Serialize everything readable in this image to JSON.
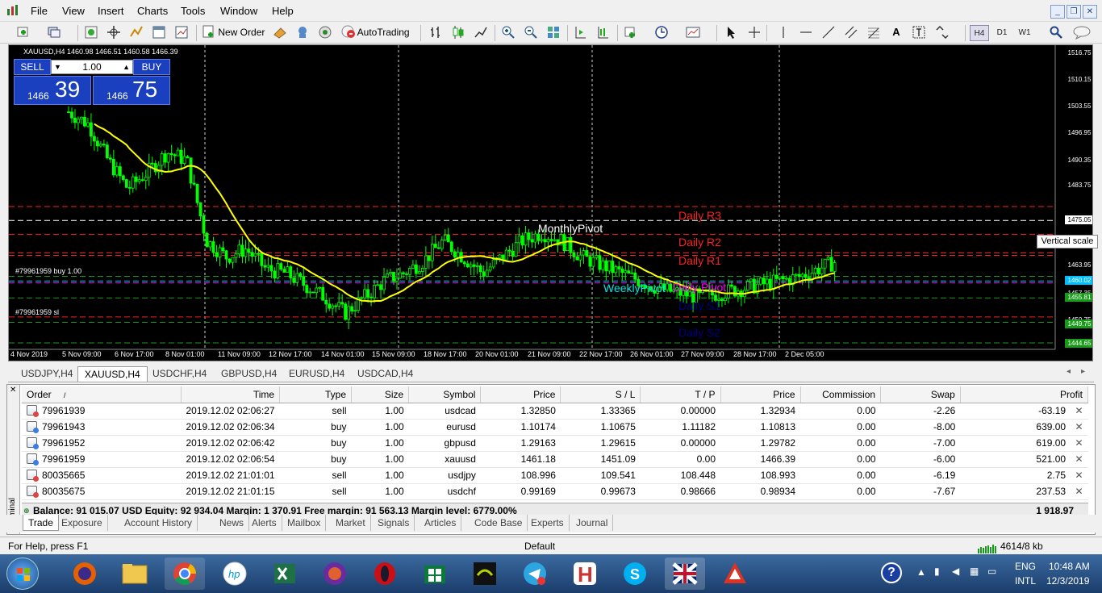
{
  "menu": [
    "File",
    "View",
    "Insert",
    "Charts",
    "Tools",
    "Window",
    "Help"
  ],
  "toolbar": {
    "new_order": "New Order",
    "auto_trading": "AutoTrading",
    "timeframes": [
      "H4",
      "D1",
      "W1"
    ]
  },
  "chart": {
    "header": "XAUUSD,H4  1460.98 1466.51 1460.58 1466.39",
    "lot": "1.00",
    "sell_label": "SELL",
    "buy_label": "BUY",
    "sell_big": "1466",
    "sell_small": "39",
    "buy_big": "1466",
    "buy_small": "75",
    "price_labels": [
      "1516.75",
      "1510.15",
      "1503.55",
      "1496.95",
      "1490.35",
      "1483.75",
      "1475.05",
      "1463.95",
      "1460.02",
      "1457.35",
      "1455.81",
      "1450.75",
      "1449.75",
      "1444.65"
    ],
    "time_labels": [
      "4 Nov 2019",
      "5 Nov 09:00",
      "6 Nov 17:00",
      "8 Nov 01:00",
      "11 Nov 09:00",
      "12 Nov 17:00",
      "14 Nov 01:00",
      "15 Nov 09:00",
      "18 Nov 17:00",
      "20 Nov 01:00",
      "21 Nov 09:00",
      "22 Nov 17:00",
      "26 Nov 01:00",
      "27 Nov 09:00",
      "28 Nov 17:00",
      "2 Dec 05:00"
    ],
    "pivot_labels": {
      "r3": "Daily R3",
      "r2": "Daily R2",
      "r1": "Daily R1",
      "monthly": "MonthlyPivot",
      "weekly": "WeeklyPivot",
      "daily": "Daily Pivot",
      "s1": "Daily S1",
      "s2": "Daily S2"
    },
    "order_line_buy": "#79961959 buy 1.00",
    "order_line_sl": "#79961959 sl",
    "tooltip": "Vertical scale"
  },
  "chart_tabs": [
    "USDJPY,H4",
    "XAUUSD,H4",
    "USDCHF,H4",
    "GBPUSD,H4",
    "EURUSD,H4",
    "USDCAD,H4"
  ],
  "orders": {
    "headers": [
      "Order",
      "/",
      "Time",
      "Type",
      "Size",
      "Symbol",
      "Price",
      "S / L",
      "T / P",
      "Price",
      "Commission",
      "Swap",
      "Profit"
    ],
    "rows": [
      {
        "order": "79961939",
        "time": "2019.12.02 02:06:27",
        "type": "sell",
        "size": "1.00",
        "symbol": "usdcad",
        "price": "1.32850",
        "sl": "1.33365",
        "tp": "0.00000",
        "cur": "1.32934",
        "comm": "0.00",
        "swap": "-2.26",
        "profit": "-63.19"
      },
      {
        "order": "79961943",
        "time": "2019.12.02 02:06:34",
        "type": "buy",
        "size": "1.00",
        "symbol": "eurusd",
        "price": "1.10174",
        "sl": "1.10675",
        "tp": "1.11182",
        "cur": "1.10813",
        "comm": "0.00",
        "swap": "-8.00",
        "profit": "639.00"
      },
      {
        "order": "79961952",
        "time": "2019.12.02 02:06:42",
        "type": "buy",
        "size": "1.00",
        "symbol": "gbpusd",
        "price": "1.29163",
        "sl": "1.29615",
        "tp": "0.00000",
        "cur": "1.29782",
        "comm": "0.00",
        "swap": "-7.00",
        "profit": "619.00"
      },
      {
        "order": "79961959",
        "time": "2019.12.02 02:06:54",
        "type": "buy",
        "size": "1.00",
        "symbol": "xauusd",
        "price": "1461.18",
        "sl": "1451.09",
        "tp": "0.00",
        "cur": "1466.39",
        "comm": "0.00",
        "swap": "-6.00",
        "profit": "521.00"
      },
      {
        "order": "80035665",
        "time": "2019.12.02 21:01:01",
        "type": "sell",
        "size": "1.00",
        "symbol": "usdjpy",
        "price": "108.996",
        "sl": "109.541",
        "tp": "108.448",
        "cur": "108.993",
        "comm": "0.00",
        "swap": "-6.19",
        "profit": "2.75"
      },
      {
        "order": "80035675",
        "time": "2019.12.02 21:01:15",
        "type": "sell",
        "size": "1.00",
        "symbol": "usdchf",
        "price": "0.99169",
        "sl": "0.99673",
        "tp": "0.98666",
        "cur": "0.98934",
        "comm": "0.00",
        "swap": "-7.67",
        "profit": "237.53"
      }
    ],
    "balance_text": "Balance: 91 015.07 USD  Equity: 92 934.04  Margin: 1 370.91  Free margin: 91 563.13  Margin level: 6779.00%",
    "total_profit": "1 918.97"
  },
  "terminal": {
    "side_label": "Terminal",
    "tabs": [
      "Trade",
      "Exposure",
      "Account History",
      "News",
      "Alerts",
      "Mailbox",
      "Market",
      "Signals",
      "Articles",
      "Code Base",
      "Experts",
      "Journal"
    ]
  },
  "status": {
    "help": "For Help, press F1",
    "profile": "Default",
    "traffic": "4614/8 kb"
  },
  "tray": {
    "lang1": "ENG",
    "lang2": "INTL",
    "time": "10:48 AM",
    "date": "12/3/2019"
  },
  "colors": {
    "candle": "#00ff00",
    "ma": "#ffff00",
    "resistance": "#ff2020",
    "support": "#000080",
    "pivot_magenta": "#ff00ff",
    "weekly_cyan": "#00e5e5"
  }
}
